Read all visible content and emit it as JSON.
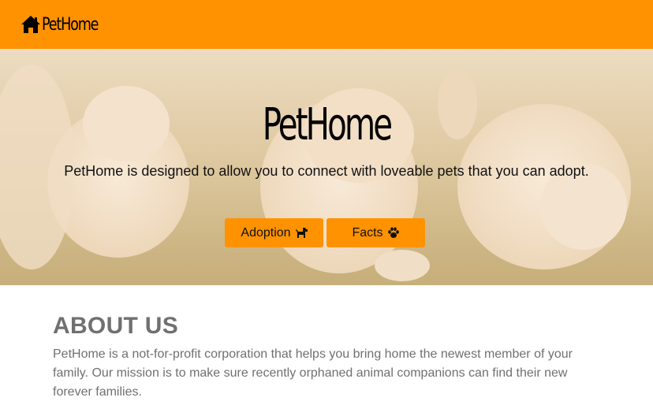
{
  "navbar": {
    "brand_text": "PetHome",
    "brand_icon": "house-icon"
  },
  "hero": {
    "title": "PetHome",
    "lead": "PetHome is designed to allow you to connect with loveable pets that you can adopt.",
    "buttons": [
      {
        "label": "Adoption",
        "icon": "dog-icon"
      },
      {
        "label": "Facts",
        "icon": "paw-icon"
      }
    ]
  },
  "about": {
    "title": "ABOUT US",
    "text": "PetHome is a not-for-profit corporation that helps you bring home the newest member of your family. Our mission is to make sure recently orphaned animal companions can find their new forever families."
  },
  "colors": {
    "accent": "#ff9200",
    "muted_text": "#707070"
  }
}
